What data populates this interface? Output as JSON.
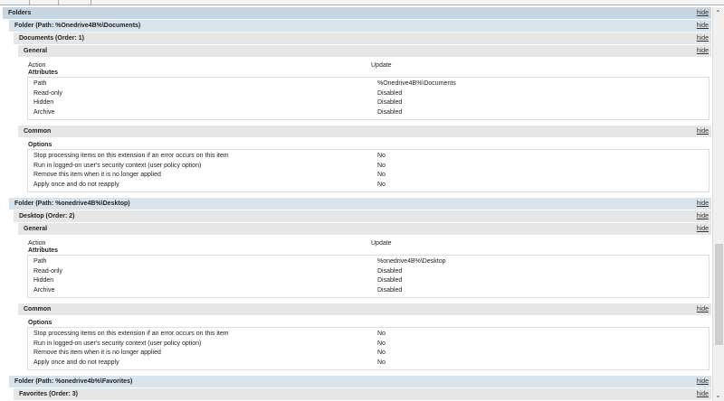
{
  "hide_label": "hide",
  "folders_title": "Folders",
  "folders": [
    {
      "header": "Folder (Path: %Onedrive4B%\\Documents)",
      "item": "Documents (Order: 1)",
      "general": "General",
      "action_label": "Action",
      "action_value": "Update",
      "attributes_label": "Attributes",
      "attributes": [
        {
          "k": "Path",
          "v": "%Onedrive4B%\\Documents"
        },
        {
          "k": "Read-only",
          "v": "Disabled"
        },
        {
          "k": "Hidden",
          "v": "Disabled"
        },
        {
          "k": "Archive",
          "v": "Disabled"
        }
      ],
      "common": "Common",
      "options_label": "Options",
      "options": [
        {
          "k": "Stop processing items on this extension if an error occurs on this item",
          "v": "No"
        },
        {
          "k": "Run in logged-on user's security context (user policy option)",
          "v": "No"
        },
        {
          "k": "Remove this item when it is no longer applied",
          "v": "No"
        },
        {
          "k": "Apply once and do not reapply",
          "v": "No"
        }
      ]
    },
    {
      "header": "Folder (Path: %onedrive4B%\\Desktop)",
      "item": "Desktop (Order: 2)",
      "general": "General",
      "action_label": "Action",
      "action_value": "Update",
      "attributes_label": "Attributes",
      "attributes": [
        {
          "k": "Path",
          "v": "%onedrive4B%\\Desktop"
        },
        {
          "k": "Read-only",
          "v": "Disabled"
        },
        {
          "k": "Hidden",
          "v": "Disabled"
        },
        {
          "k": "Archive",
          "v": "Disabled"
        }
      ],
      "common": "Common",
      "options_label": "Options",
      "options": [
        {
          "k": "Stop processing items on this extension if an error occurs on this item",
          "v": "No"
        },
        {
          "k": "Run in logged-on user's security context (user policy option)",
          "v": "No"
        },
        {
          "k": "Remove this item when it is no longer applied",
          "v": "No"
        },
        {
          "k": "Apply once and do not reapply",
          "v": "No"
        }
      ]
    },
    {
      "header": "Folder (Path: %onedrive4b%\\Favorites)",
      "item": "Favorites (Order: 3)"
    }
  ]
}
